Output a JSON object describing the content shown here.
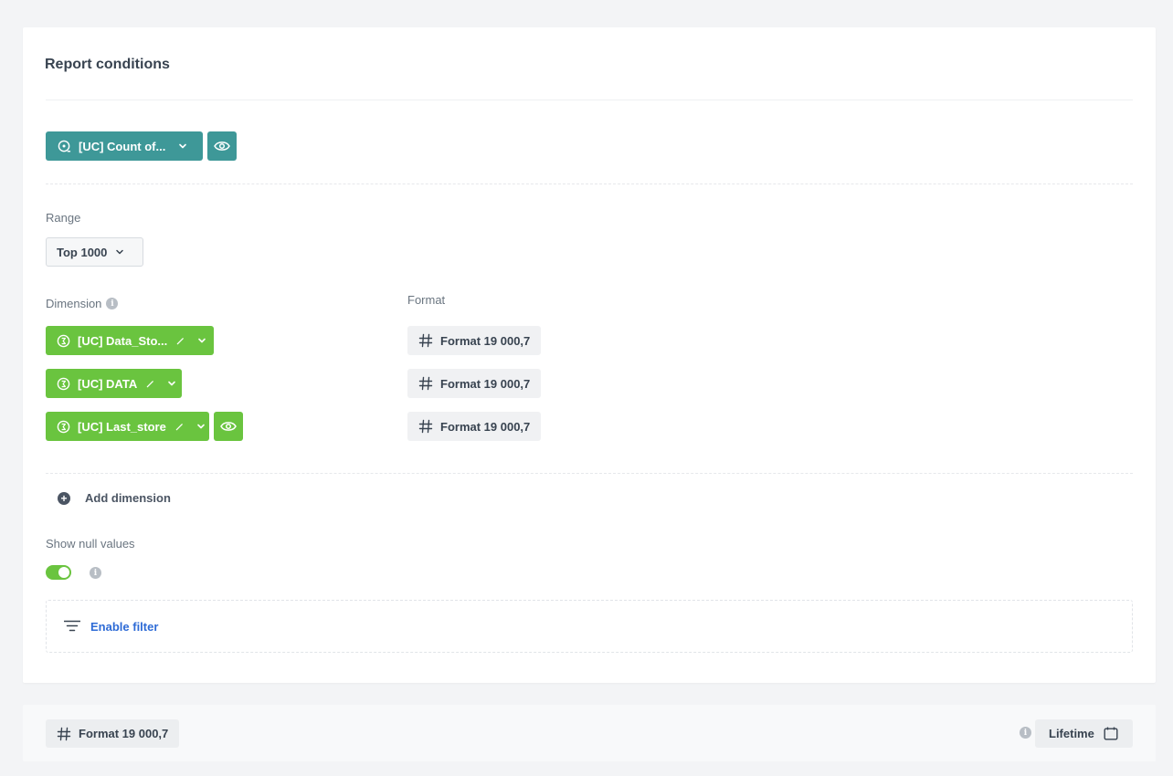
{
  "card": {
    "title": "Report conditions"
  },
  "metric": {
    "label": "[UC] Count of...",
    "icon": "metric-icon",
    "visibility_icon": "eye-icon"
  },
  "range": {
    "label": "Range",
    "value": "Top 1000"
  },
  "dimension": {
    "label": "Dimension",
    "format_label": "Format",
    "items": [
      {
        "label": "[UC] Data_Sto...",
        "format": "Format 19 000,7"
      },
      {
        "label": "[UC] DATA",
        "format": "Format 19 000,7"
      },
      {
        "label": "[UC] Last_store",
        "format": "Format 19 000,7"
      }
    ],
    "add_label": "Add dimension"
  },
  "null_values": {
    "label": "Show null values",
    "enabled": true
  },
  "filter": {
    "label": "Enable filter"
  },
  "footer": {
    "format": "Format 19 000,7",
    "period": "Lifetime"
  },
  "colors": {
    "teal": "#3e9898",
    "green": "#6ac43f",
    "link_blue": "#2e6bd6"
  }
}
